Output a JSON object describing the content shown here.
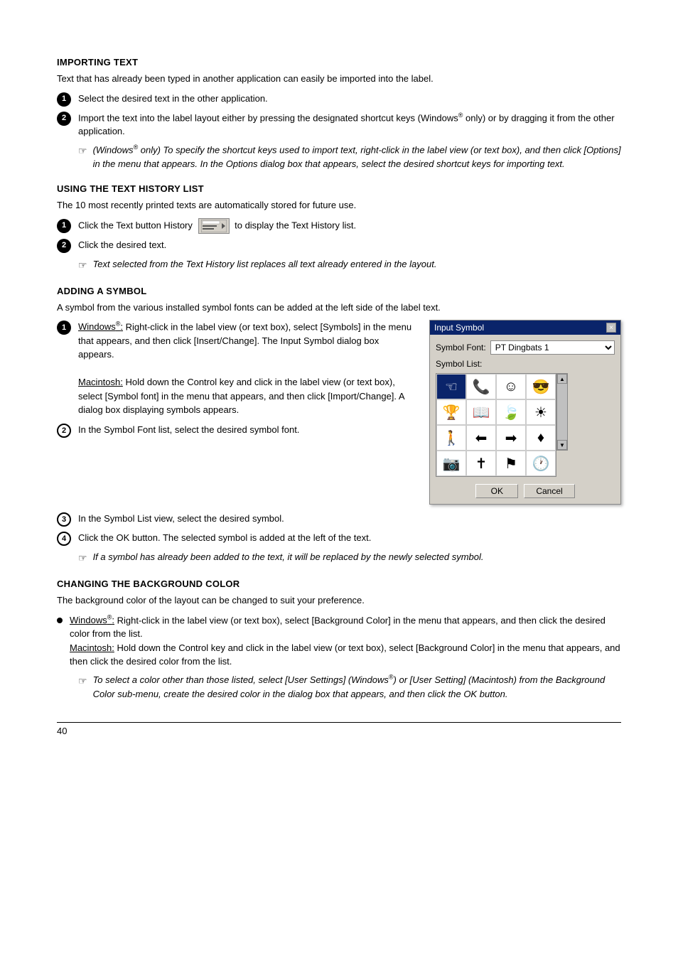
{
  "sections": {
    "importing_text": {
      "title": "IMPORTING TEXT",
      "desc": "Text that has already been typed in another application can easily be imported into the label.",
      "steps": [
        {
          "num": "1",
          "text": "Select the desired text in the other application."
        },
        {
          "num": "2",
          "text": "Import the text into the label layout either by pressing the designated shortcut keys (Windows® only) or by dragging it from the other application."
        }
      ],
      "note": "(Windows® only) To specify the shortcut keys used to import text, right-click in the label view (or text box), and then click [Options] in the menu that appears. In the Options dialog box that appears, select the desired shortcut keys for importing text."
    },
    "text_history": {
      "title": "USING THE TEXT HISTORY LIST",
      "desc": "The 10 most recently printed texts are automatically stored for future use.",
      "steps": [
        {
          "num": "1",
          "text_before": "Click the Text History button",
          "text_after": "to display the Text History list."
        },
        {
          "num": "2",
          "text": "Click the desired text."
        }
      ],
      "note": "Text selected from the Text History list replaces all text already entered in the layout."
    },
    "adding_symbol": {
      "title": "ADDING A SYMBOL",
      "desc": "A symbol from the various installed symbol fonts can be added at the left side of the label text.",
      "step1": {
        "windows_label": "Windows®:",
        "windows_text": " Right-click in the label view (or text box), select [Symbols] in the menu that appears, and then click [Insert/Change]. The Input Symbol dialog box appears.",
        "mac_label": "Macintosh:",
        "mac_text": " Hold down the Control key and click in the label view (or text box), select [Symbol font] in the menu that appears, and then click [Import/Change]. A dialog box displaying symbols appears."
      },
      "step2": "In the Symbol Font list, select the desired symbol font.",
      "step3": "In the Symbol List view, select the desired symbol.",
      "step4": "Click the OK button. The selected symbol is added at the left of the text.",
      "note": "If a symbol has already been added to the text, it will be replaced by the newly selected symbol."
    },
    "background_color": {
      "title": "CHANGING THE BACKGROUND COLOR",
      "desc": "The background color of the layout can be changed to suit your preference.",
      "bullet1": {
        "windows_label": "Windows®:",
        "windows_text": " Right-click in the label view (or text box), select [Background Color] in the menu that appears, and then click the desired color from the list.",
        "mac_label": "Macintosh:",
        "mac_text": " Hold down the Control key and click in the label view (or text box), select [Background Color] in the menu that appears, and then click the desired color from the list."
      },
      "note": "To select a color other than those listed, select [User Settings] (Windows®) or [User Setting] (Macintosh) from the Background Color sub-menu, create the desired color in the dialog box that appears, and then click the OK button."
    }
  },
  "dialog": {
    "title": "Input Symbol",
    "symbol_font_label": "Symbol Font:",
    "symbol_font_value": "PT Dingbats 1",
    "symbol_list_label": "Symbol List:",
    "ok_button": "OK",
    "cancel_button": "Cancel",
    "close_icon": "×"
  },
  "page_number": "40"
}
